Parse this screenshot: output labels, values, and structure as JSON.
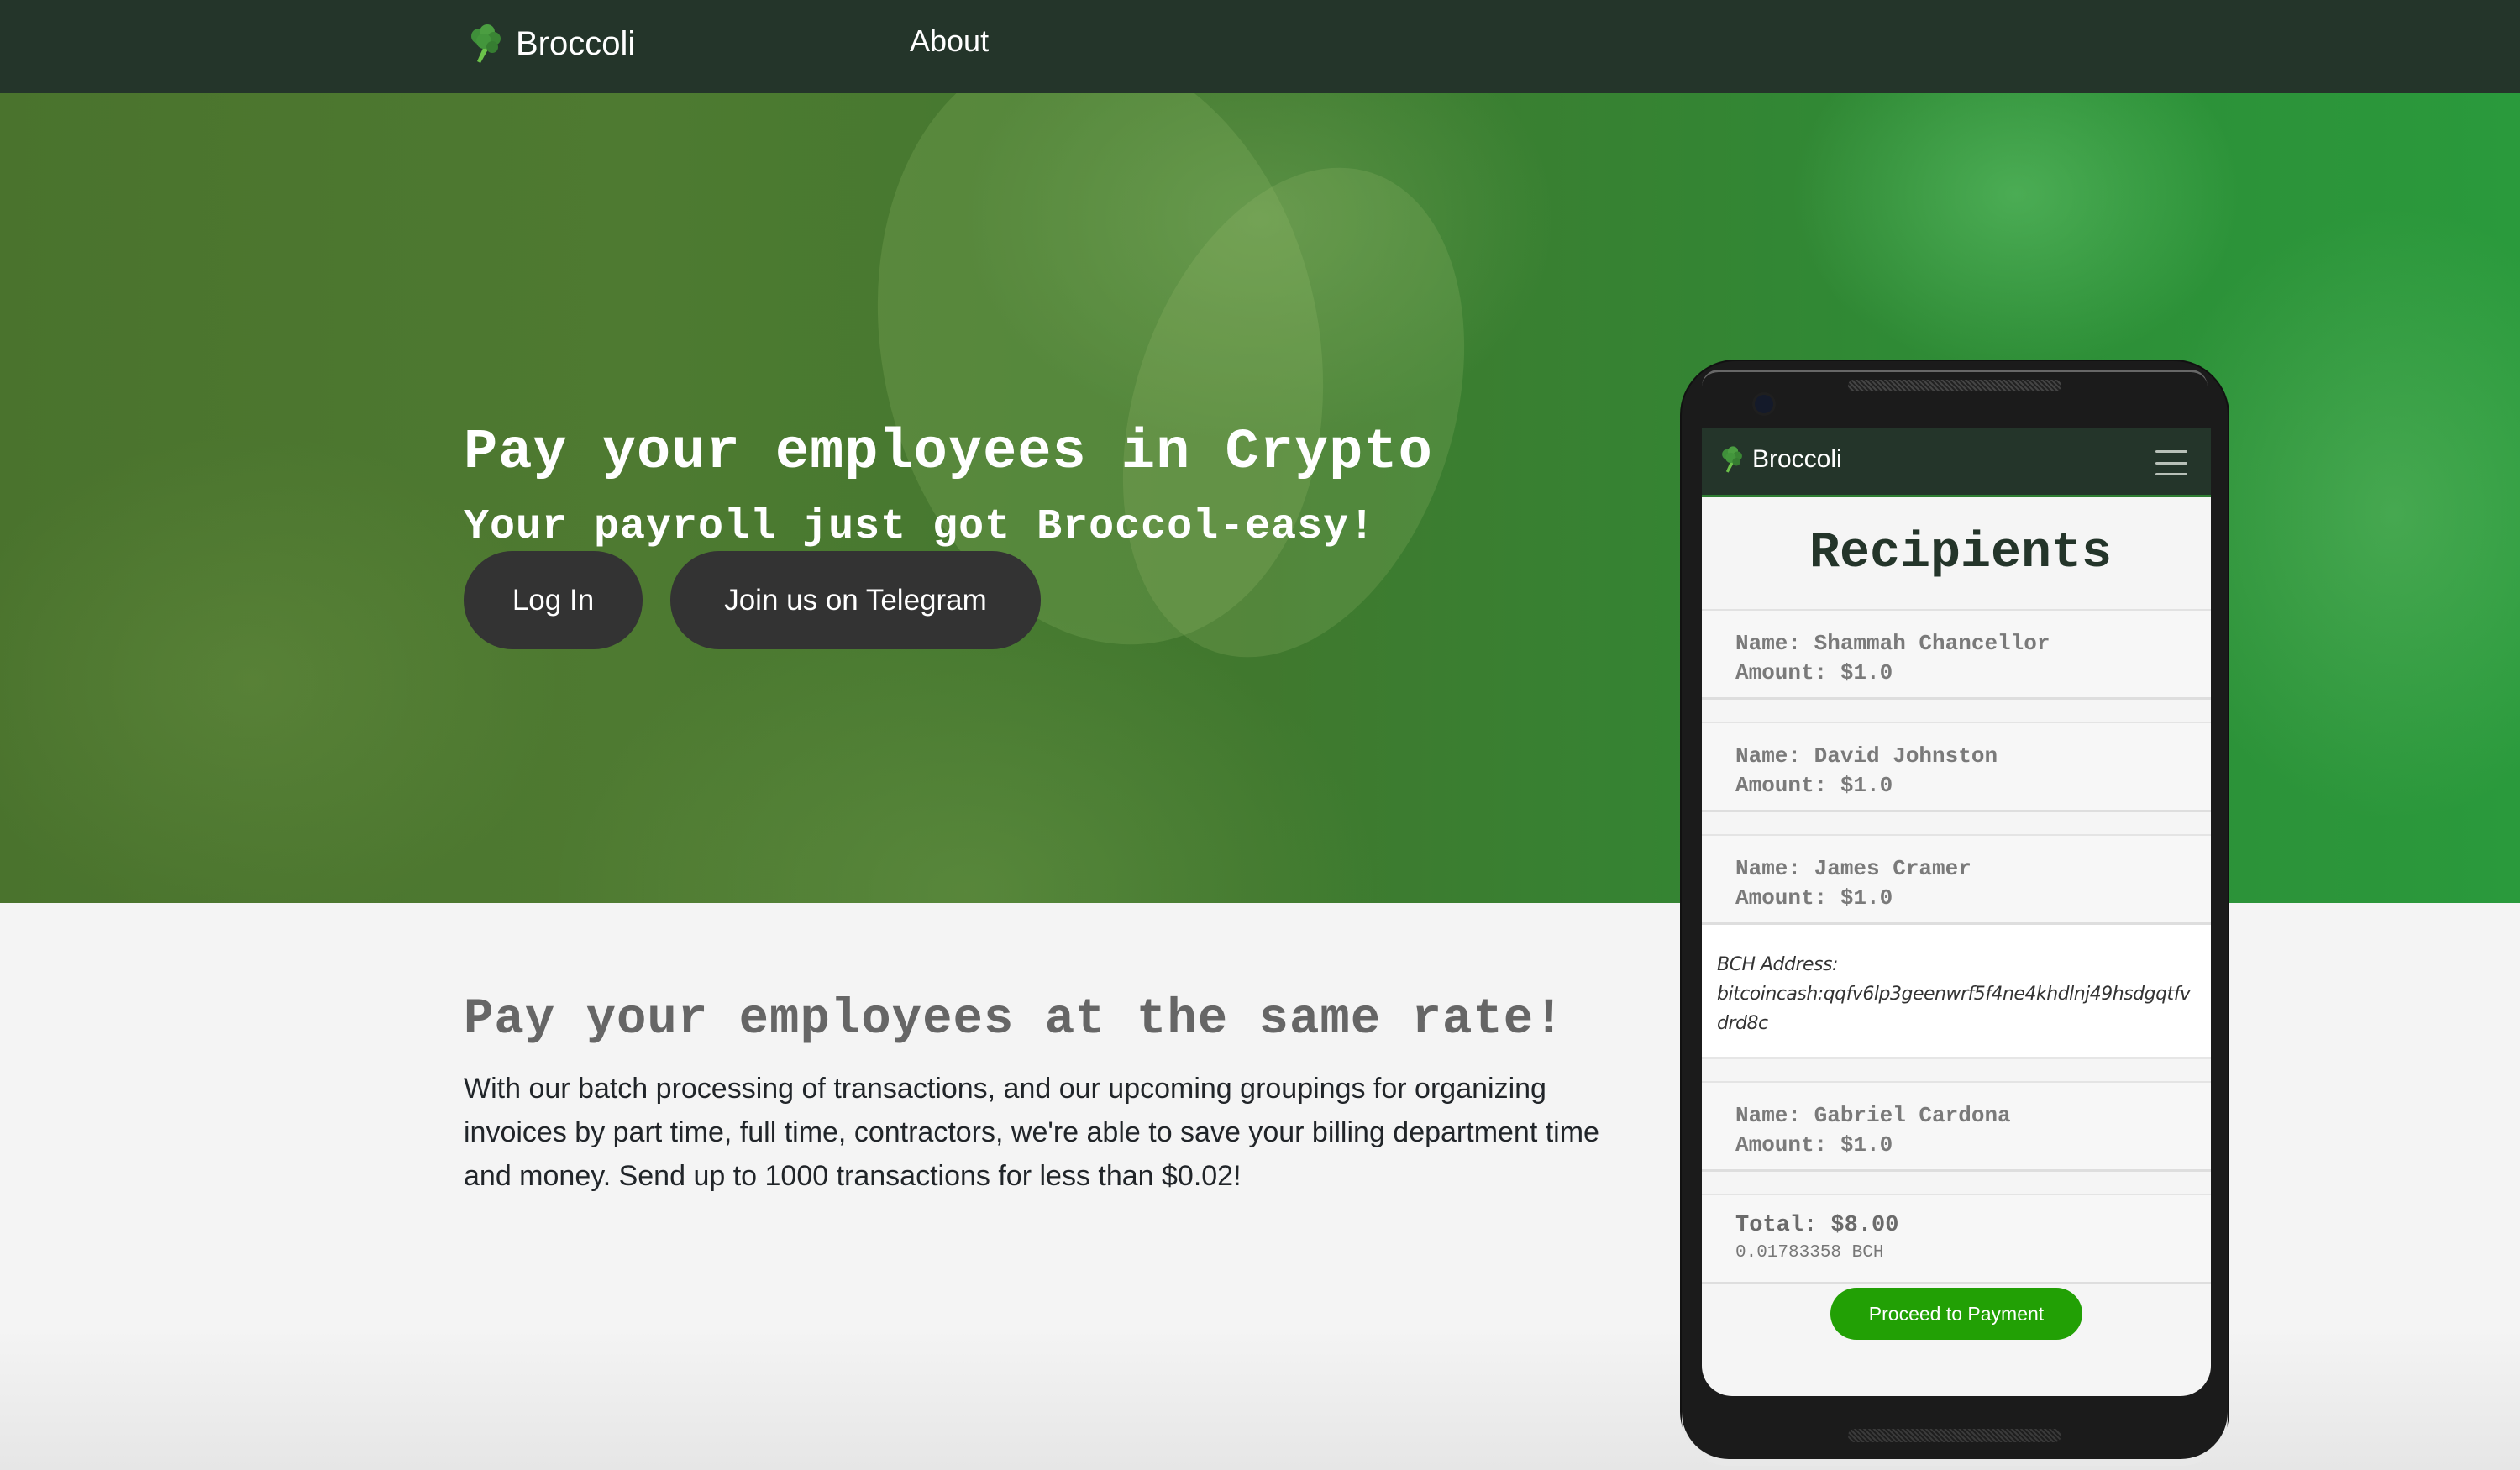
{
  "nav": {
    "brand_icon": "broccoli-icon",
    "brand": "Broccoli",
    "links": [
      {
        "label": "About"
      }
    ]
  },
  "hero": {
    "title": "Pay your employees in Crypto",
    "subtitle": "Your payroll just got Broccol-easy!",
    "buttons": {
      "login": "Log In",
      "telegram": "Join us on Telegram"
    }
  },
  "section": {
    "title": "Pay your employees at the same rate!",
    "text": "With our batch processing of transactions, and our upcoming groupings for organizing invoices by part time, full time, contractors, we're able to save your billing department time and money. Send up to 1000 transactions for less than $0.02!"
  },
  "phone": {
    "nav": {
      "brand_icon": "broccoli-icon",
      "brand": "Broccoli",
      "menu_icon": "hamburger-menu-icon"
    },
    "title": "Recipients",
    "recipients": [
      {
        "name": "Name: Shammah Chancellor",
        "amount": "Amount: $1.0"
      },
      {
        "name": "Name: David Johnston",
        "amount": "Amount: $1.0"
      },
      {
        "name": "Name: James Cramer",
        "amount": "Amount: $1.0"
      },
      {
        "name": "Name: Gabriel Cardona",
        "amount": "Amount: $1.0"
      }
    ],
    "bch_address": {
      "label": "BCH Address:",
      "value": "bitcoincash:qqfv6lp3geenwrf5f4ne4khdlnj49hsdgqtfvdrd8c"
    },
    "total": "Total: $8.00",
    "total_bch": "0.01783358 BCH",
    "pay_button": "Proceed to Payment"
  },
  "colors": {
    "nav_bg": "#24352a",
    "button_dark": "#333333",
    "pay_green": "#22a005",
    "section_bg": "#f4f4f4"
  }
}
